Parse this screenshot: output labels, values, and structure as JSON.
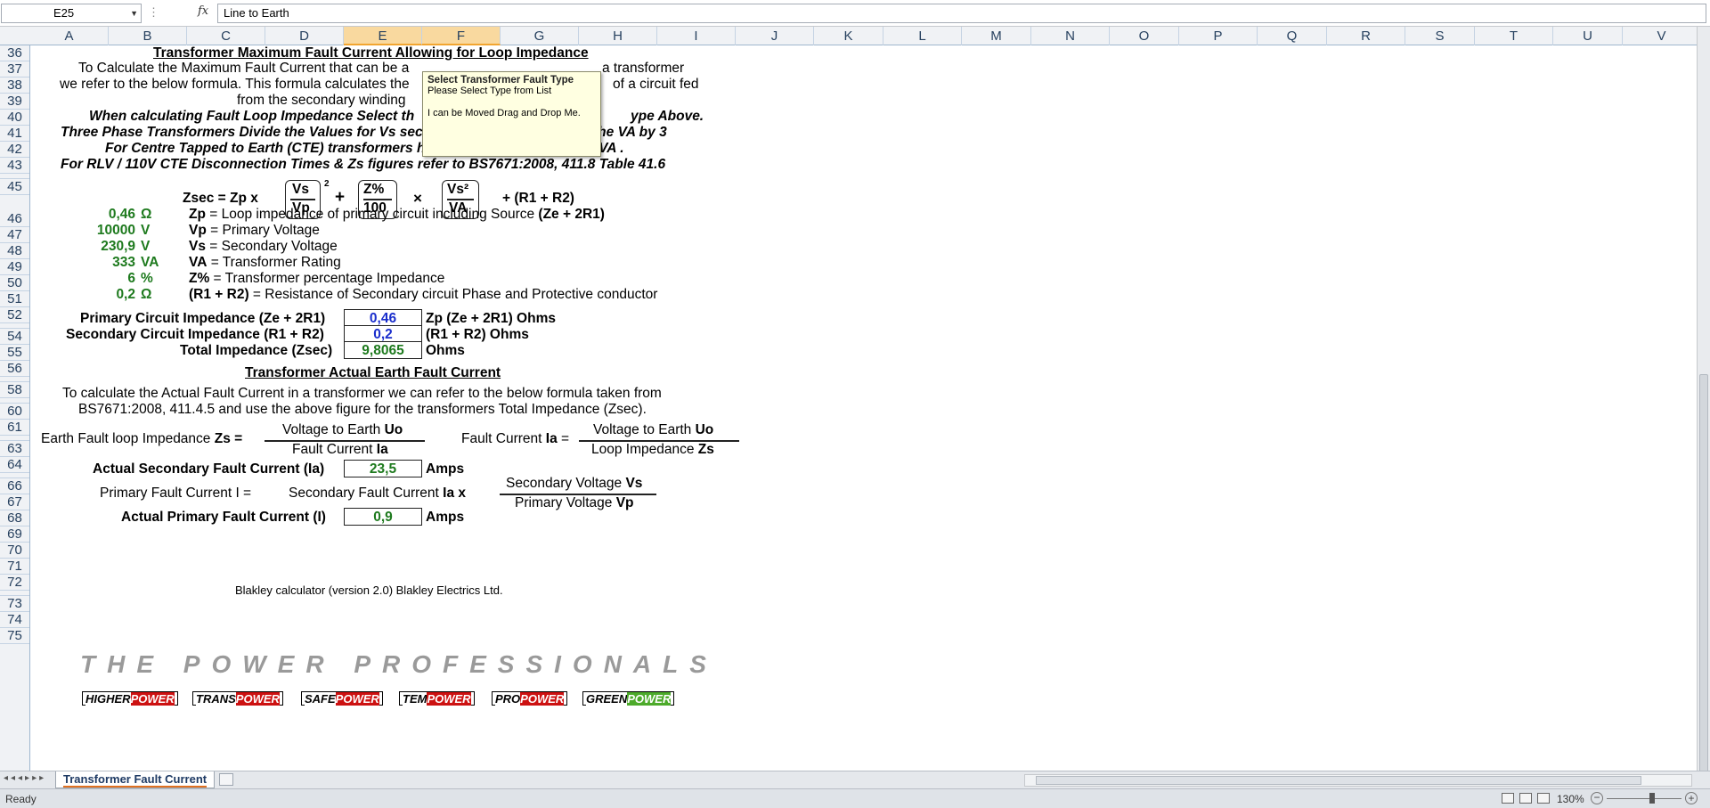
{
  "formula_bar": {
    "name_box": "E25",
    "fx": "fx",
    "value": "Line to Earth"
  },
  "columns": [
    {
      "label": "A",
      "w": 88
    },
    {
      "label": "B",
      "w": 88
    },
    {
      "label": "C",
      "w": 88
    },
    {
      "label": "D",
      "w": 88
    },
    {
      "label": "E",
      "w": 88
    },
    {
      "label": "F",
      "w": 88
    },
    {
      "label": "G",
      "w": 88
    },
    {
      "label": "H",
      "w": 88
    },
    {
      "label": "I",
      "w": 88
    },
    {
      "label": "J",
      "w": 88
    },
    {
      "label": "K",
      "w": 78
    },
    {
      "label": "L",
      "w": 88
    },
    {
      "label": "M",
      "w": 78
    },
    {
      "label": "N",
      "w": 88
    },
    {
      "label": "O",
      "w": 78
    },
    {
      "label": "P",
      "w": 88
    },
    {
      "label": "Q",
      "w": 78
    },
    {
      "label": "R",
      "w": 88
    },
    {
      "label": "S",
      "w": 78
    },
    {
      "label": "T",
      "w": 88
    },
    {
      "label": "U",
      "w": 78
    },
    {
      "label": "V",
      "w": 88
    }
  ],
  "rows": [
    "36",
    "37",
    "38",
    "39",
    "40",
    "41",
    "42",
    "43",
    "",
    "45",
    "46",
    "47",
    "48",
    "49",
    "50",
    "51",
    "52",
    "",
    "54",
    "55",
    "56",
    "",
    "58",
    "",
    "60",
    "61",
    "",
    "63",
    "64",
    "",
    "66",
    "67",
    "68",
    "69",
    "70",
    "71",
    "72",
    "",
    "73",
    "74",
    "75"
  ],
  "sheet": {
    "title1": "Transformer Maximum Fault Current Allowing for Loop Impedance",
    "p37": "To Calculate the Maximum Fault Current that can be a",
    "p37b": "a transformer",
    "p38": "we refer to the below formula. This formula calculates the",
    "p38b": "of a circuit fed",
    "p39": "from the secondary winding",
    "p40": "When calculating Fault Loop Impedance Select th",
    "p40b": "ype Above.",
    "p41": "Three Phase Transformers Divide the Values for Vs secondary Voltage by √3 and the VA by 3",
    "p42": "For Centre Tapped to Earth (CTE) transformers halve the values for Vs and VA .",
    "p43": "For RLV / 110V CTE Disconnection Times & Zs figures refer to BS7671:2008, 411.8 Table 41.6",
    "zsec_label": "Zsec = Zp x",
    "vs": "Vs",
    "vp": "Vp",
    "sq": "2",
    "plus": "+",
    "zpct": "Z%",
    "hundred": "100",
    "times": "×",
    "vs2": "Vs²",
    "va": "VA",
    "plus_r": "+ (R1 + R2)",
    "inputs": [
      {
        "val": "0,46",
        "unit": "Ω",
        "sym": "Zp",
        "desc": " = Loop impedance of primary circuit including Source ",
        "extra": "(Ze + 2R1)"
      },
      {
        "val": "10000",
        "unit": "V",
        "sym": "Vp",
        "desc": " = Primary Voltage",
        "extra": ""
      },
      {
        "val": "230,9",
        "unit": "V",
        "sym": "Vs",
        "desc": " = Secondary Voltage",
        "extra": ""
      },
      {
        "val": "333",
        "unit": "VA",
        "sym": "VA",
        "desc": " = Transformer Rating",
        "extra": ""
      },
      {
        "val": "6",
        "unit": "%",
        "sym": "Z%",
        "desc": " = Transformer percentage Impedance",
        "extra": ""
      },
      {
        "val": "0,2",
        "unit": "Ω",
        "sym": "(R1 + R2)",
        "desc": " = Resistance of Secondary circuit Phase and Protective conductor",
        "extra": ""
      }
    ],
    "r54_label": "Primary Circuit Impedance (Ze + 2R1)",
    "r54_val": "0,46",
    "r54_unit": "Zp (Ze + 2R1) Ohms",
    "r55_label": "Secondary Circuit Impedance (R1 + R2)",
    "r55_val": "0,2",
    "r55_unit": "(R1 + R2) Ohms",
    "r56_label": "Total Impedance (Zsec)",
    "r56_val": "9,8065",
    "r56_unit": "Ohms",
    "title2": "Transformer Actual Earth Fault Current",
    "p60": "To calculate the Actual Fault Current in a transformer we can refer to the below formula taken from",
    "p61": "BS7671:2008, 411.4.5 and use the above figure for the transformers Total Impedance (Zsec).",
    "efli_label": "Earth Fault loop Impedance ",
    "efli_zs": "Zs =",
    "vte": "Voltage to Earth ",
    "uo": "Uo",
    "fc": "Fault Current ",
    "ia": "Ia",
    "fci_label": "Fault Current ",
    "fci_ia": "Ia",
    "eq": " =",
    "li": "Loop Impedance ",
    "zs": "Zs",
    "r66_label": "Actual Secondary Fault Current (Ia)",
    "r66_val": "23,5",
    "r66_unit": "Amps",
    "pfc_label": "Primary Fault Current I =",
    "sfc": "Secondary Fault Current ",
    "sfc_ia": "Ia x",
    "sv": "Secondary Voltage ",
    "sv_vs": "Vs",
    "pv": "Primary Voltage ",
    "pv_vp": "Vp",
    "r69_label": "Actual Primary Fault Current (I)",
    "r69_val": "0,9",
    "r69_unit": "Amps",
    "brand": "THE POWER PROFESSIONALS",
    "logos": [
      {
        "a": "HIGHER",
        "z": "POWER"
      },
      {
        "a": "TRANS",
        "z": "POWER"
      },
      {
        "a": "SAFE",
        "z": "POWER"
      },
      {
        "a": "TEM",
        "z": "POWER"
      },
      {
        "a": "PRO",
        "z": "POWER"
      },
      {
        "a": "GREEN",
        "z": "POWER"
      }
    ],
    "footer": "Blakley calculator (version 2.0) Blakley Electrics Ltd."
  },
  "tooltip": {
    "title": "Select Transformer Fault Type",
    "line1": "Please Select Type from List",
    "line2": "I can be Moved Drag and Drop Me."
  },
  "tabs": {
    "active": "Transformer Fault Current"
  },
  "status": {
    "ready": "Ready",
    "zoom": "130%",
    "minus": "−",
    "plus": "+"
  }
}
